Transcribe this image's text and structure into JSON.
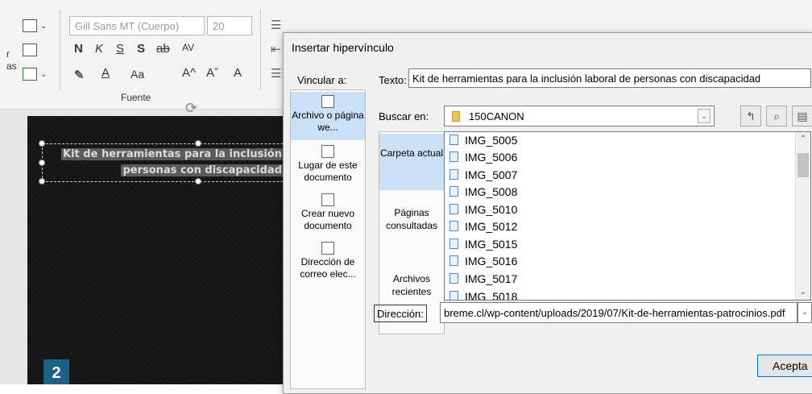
{
  "ribbon": {
    "font_name": "Gill Sans MT (Cuerpo)",
    "font_size": "20",
    "bold": "N",
    "italic": "K",
    "underline": "S",
    "shadow": "S",
    "strike": "ab",
    "spacing": "AV",
    "case": "Aa",
    "grow": "A^",
    "shrink": "Aˇ",
    "group_label": "Fuente",
    "left_labels": [
      "r",
      "as"
    ]
  },
  "slide": {
    "title_line1": "Kit de herramientas para la inclusión",
    "title_line2": "personas con discapacidad",
    "page_number": "2"
  },
  "dialog": {
    "title": "Insertar hipervínculo",
    "vincular_label": "Vincular a:",
    "link_options": [
      {
        "label": "Archivo o página we...",
        "active": true
      },
      {
        "label": "Lugar de este documento",
        "active": false
      },
      {
        "label": "Crear nuevo documento",
        "active": false
      },
      {
        "label": "Dirección de correo elec...",
        "active": false
      }
    ],
    "texto_label": "Texto:",
    "texto_value": "Kit de herramientas para la inclusión laboral de personas con discapacidad",
    "buscar_label": "Buscar en:",
    "buscar_value": "150CANON",
    "places": [
      {
        "label": "Carpeta actual",
        "active": true
      },
      {
        "label": "Páginas consultadas",
        "active": false
      },
      {
        "label": "Archivos recientes",
        "active": false
      }
    ],
    "files": [
      "IMG_5005",
      "IMG_5006",
      "IMG_5007",
      "IMG_5008",
      "IMG_5010",
      "IMG_5012",
      "IMG_5015",
      "IMG_5016",
      "IMG_5017",
      "IMG_5018"
    ],
    "direccion_label": "Dirección:",
    "direccion_value": "breme.cl/wp-content/uploads/2019/07/Kit-de-herramientas-patrocinios.pdf",
    "accept_label": "Acepta"
  }
}
